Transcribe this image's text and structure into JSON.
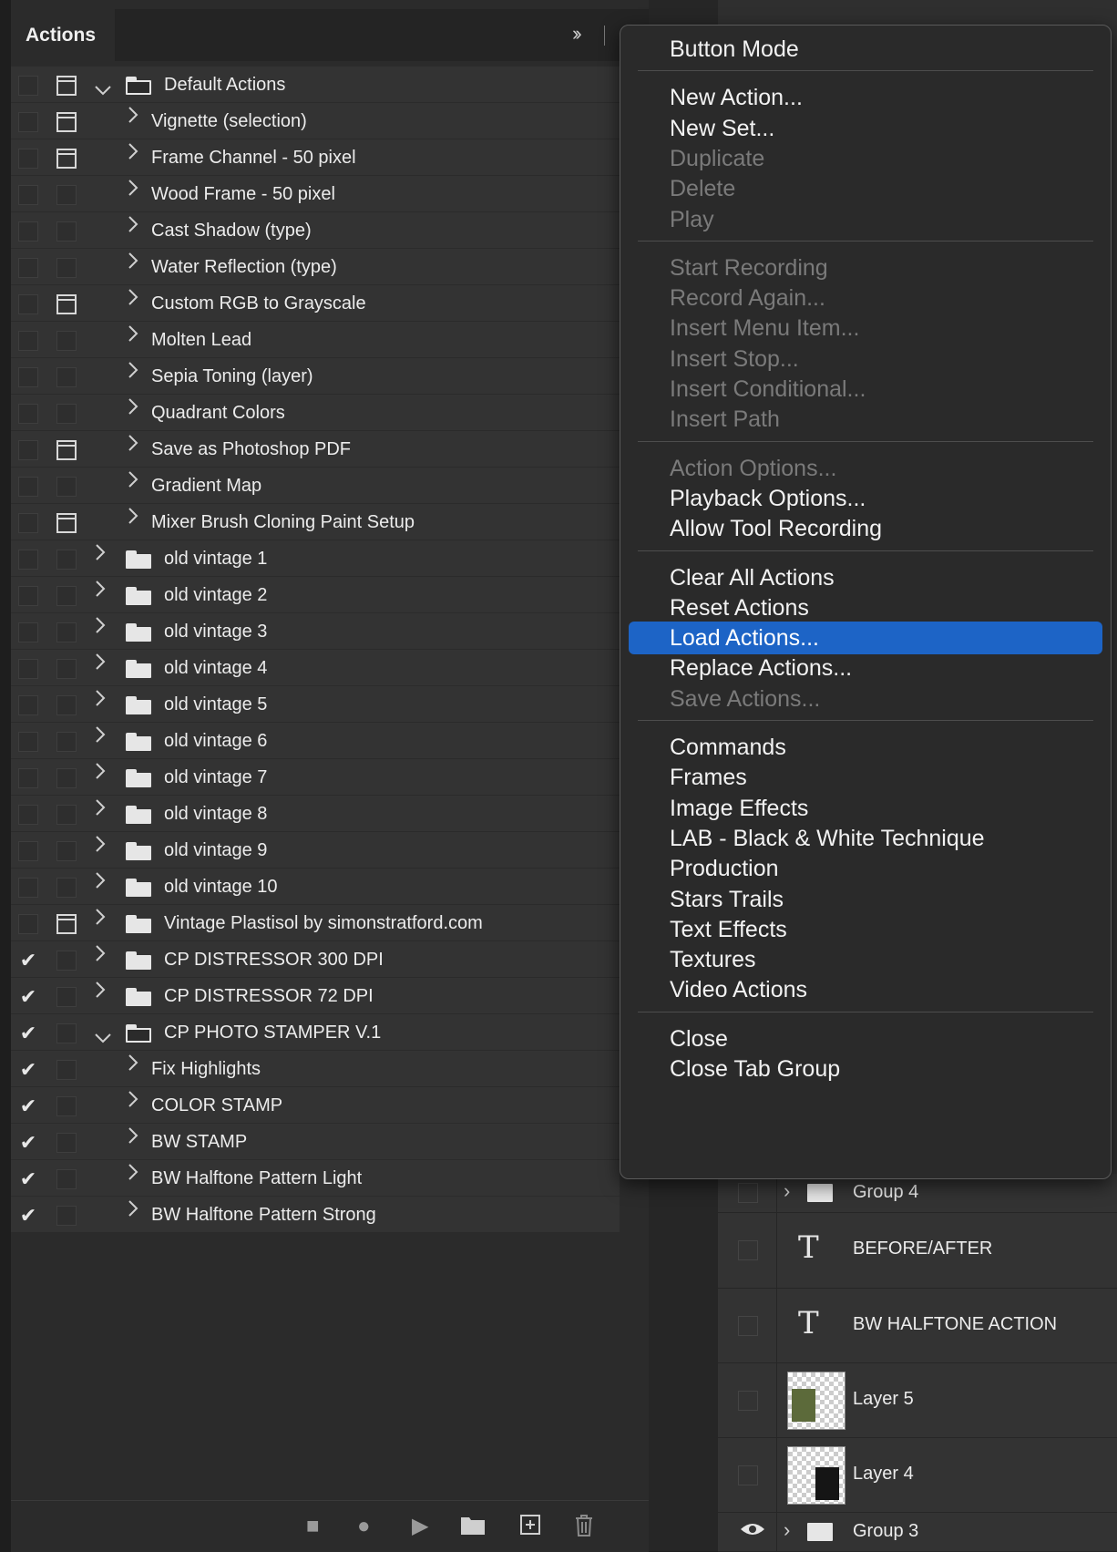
{
  "panel": {
    "tab_title": "Actions",
    "collapse_glyph": "»"
  },
  "actions": [
    {
      "kind": "set",
      "label": "Default Actions",
      "checked": false,
      "dialog": true,
      "expanded": true
    },
    {
      "kind": "action",
      "label": "Vignette (selection)",
      "checked": false,
      "dialog": true
    },
    {
      "kind": "action",
      "label": "Frame Channel - 50 pixel",
      "checked": false,
      "dialog": true
    },
    {
      "kind": "action",
      "label": "Wood Frame - 50 pixel",
      "checked": false,
      "dialog": false
    },
    {
      "kind": "action",
      "label": "Cast Shadow (type)",
      "checked": false,
      "dialog": false
    },
    {
      "kind": "action",
      "label": "Water Reflection (type)",
      "checked": false,
      "dialog": false
    },
    {
      "kind": "action",
      "label": "Custom RGB to Grayscale",
      "checked": false,
      "dialog": true
    },
    {
      "kind": "action",
      "label": "Molten Lead",
      "checked": false,
      "dialog": false
    },
    {
      "kind": "action",
      "label": "Sepia Toning (layer)",
      "checked": false,
      "dialog": false
    },
    {
      "kind": "action",
      "label": "Quadrant Colors",
      "checked": false,
      "dialog": false
    },
    {
      "kind": "action",
      "label": "Save as Photoshop PDF",
      "checked": false,
      "dialog": true
    },
    {
      "kind": "action",
      "label": "Gradient Map",
      "checked": false,
      "dialog": false
    },
    {
      "kind": "action",
      "label": "Mixer Brush Cloning Paint Setup",
      "checked": false,
      "dialog": true
    },
    {
      "kind": "set",
      "label": "old vintage 1",
      "checked": false,
      "dialog": false,
      "expanded": false
    },
    {
      "kind": "set",
      "label": "old vintage 2",
      "checked": false,
      "dialog": false,
      "expanded": false
    },
    {
      "kind": "set",
      "label": "old vintage 3",
      "checked": false,
      "dialog": false,
      "expanded": false
    },
    {
      "kind": "set",
      "label": "old vintage 4",
      "checked": false,
      "dialog": false,
      "expanded": false
    },
    {
      "kind": "set",
      "label": "old vintage 5",
      "checked": false,
      "dialog": false,
      "expanded": false
    },
    {
      "kind": "set",
      "label": "old vintage 6",
      "checked": false,
      "dialog": false,
      "expanded": false
    },
    {
      "kind": "set",
      "label": "old vintage 7",
      "checked": false,
      "dialog": false,
      "expanded": false
    },
    {
      "kind": "set",
      "label": "old vintage 8",
      "checked": false,
      "dialog": false,
      "expanded": false
    },
    {
      "kind": "set",
      "label": "old vintage 9",
      "checked": false,
      "dialog": false,
      "expanded": false
    },
    {
      "kind": "set",
      "label": "old vintage 10",
      "checked": false,
      "dialog": false,
      "expanded": false
    },
    {
      "kind": "set",
      "label": "Vintage Plastisol by simonstratford.com",
      "checked": false,
      "dialog": true,
      "expanded": false
    },
    {
      "kind": "set",
      "label": "CP DISTRESSOR 300 DPI",
      "checked": true,
      "dialog": false,
      "expanded": false
    },
    {
      "kind": "set",
      "label": "CP DISTRESSOR 72 DPI",
      "checked": true,
      "dialog": false,
      "expanded": false
    },
    {
      "kind": "set",
      "label": "CP PHOTO STAMPER V.1",
      "checked": true,
      "dialog": false,
      "expanded": true
    },
    {
      "kind": "action",
      "label": "Fix Highlights",
      "checked": true,
      "dialog": false
    },
    {
      "kind": "action",
      "label": "COLOR STAMP",
      "checked": true,
      "dialog": false
    },
    {
      "kind": "action",
      "label": "BW STAMP",
      "checked": true,
      "dialog": false
    },
    {
      "kind": "action",
      "label": "BW Halftone Pattern Light",
      "checked": true,
      "dialog": false
    },
    {
      "kind": "action",
      "label": "BW Halftone Pattern Strong",
      "checked": true,
      "dialog": false
    }
  ],
  "toolbar": {
    "stop_icon": "stop-icon",
    "record_icon": "record-icon",
    "play_icon": "play-icon",
    "new_set_icon": "folder-icon",
    "new_action_icon": "new-item-icon",
    "delete_icon": "trash-icon"
  },
  "menu": {
    "groups": [
      [
        {
          "label": "Button Mode",
          "enabled": true
        }
      ],
      [
        {
          "label": "New Action...",
          "enabled": true
        },
        {
          "label": "New Set...",
          "enabled": true
        },
        {
          "label": "Duplicate",
          "enabled": false
        },
        {
          "label": "Delete",
          "enabled": false
        },
        {
          "label": "Play",
          "enabled": false
        }
      ],
      [
        {
          "label": "Start Recording",
          "enabled": false
        },
        {
          "label": "Record Again...",
          "enabled": false
        },
        {
          "label": "Insert Menu Item...",
          "enabled": false
        },
        {
          "label": "Insert Stop...",
          "enabled": false
        },
        {
          "label": "Insert Conditional...",
          "enabled": false
        },
        {
          "label": "Insert Path",
          "enabled": false
        }
      ],
      [
        {
          "label": "Action Options...",
          "enabled": false
        },
        {
          "label": "Playback Options...",
          "enabled": true
        },
        {
          "label": "Allow Tool Recording",
          "enabled": true
        }
      ],
      [
        {
          "label": "Clear All Actions",
          "enabled": true
        },
        {
          "label": "Reset Actions",
          "enabled": true
        },
        {
          "label": "Load Actions...",
          "enabled": true,
          "highlighted": true
        },
        {
          "label": "Replace Actions...",
          "enabled": true
        },
        {
          "label": "Save Actions...",
          "enabled": false
        }
      ],
      [
        {
          "label": "Commands",
          "enabled": true
        },
        {
          "label": "Frames",
          "enabled": true
        },
        {
          "label": "Image Effects",
          "enabled": true
        },
        {
          "label": "LAB - Black & White Technique",
          "enabled": true
        },
        {
          "label": "Production",
          "enabled": true
        },
        {
          "label": "Stars Trails",
          "enabled": true
        },
        {
          "label": "Text Effects",
          "enabled": true
        },
        {
          "label": "Textures",
          "enabled": true
        },
        {
          "label": "Video Actions",
          "enabled": true
        }
      ],
      [
        {
          "label": "Close",
          "enabled": true
        },
        {
          "label": "Close Tab Group",
          "enabled": true
        }
      ]
    ]
  },
  "layers": [
    {
      "kind": "group",
      "name": "Group 4",
      "visible": false
    },
    {
      "kind": "text",
      "name": "BEFORE/AFTER",
      "visible": false
    },
    {
      "kind": "text",
      "name": "BW HALFTONE ACTION",
      "visible": false
    },
    {
      "kind": "image",
      "name": "Layer 5",
      "visible": false
    },
    {
      "kind": "image",
      "name": "Layer 4",
      "visible": false
    },
    {
      "kind": "group",
      "name": "Group 3",
      "visible": true
    }
  ],
  "colors": {
    "menu_highlight": "#1d64c6",
    "panel_bg": "#2b2b2b",
    "row_bg": "#333333"
  }
}
